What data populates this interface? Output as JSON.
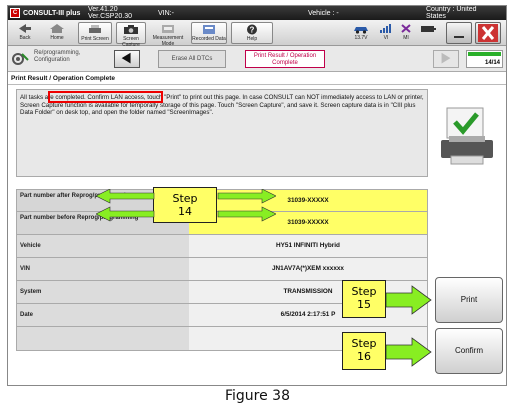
{
  "titlebar": {
    "app_name": "CONSULT-III plus",
    "version1": "Ver.41.20",
    "version2": "Ver.CSP20.30",
    "vin_label": "VIN:-",
    "vehicle_label": "Vehicle : -",
    "country_label": "Country : United",
    "country_label2": "States"
  },
  "toolbar": {
    "back": "Back",
    "home": "Home",
    "print_screen": "Print Screen",
    "screen_capture": "Screen Capture",
    "measurement_mode": "Measurement Mode",
    "recorded_data": "Recorded Data",
    "help": "Help",
    "voltage": "13.7V",
    "vi": "VI",
    "mi": "MI"
  },
  "navbar": {
    "crumb1": "Re/programming, Configuration",
    "crumb2": "Erase All DTCs",
    "crumb3": "Print Result / Operation Complete",
    "page_counter": "14/14"
  },
  "page_title": "Print Result / Operation Complete",
  "message": "All tasks are completed. Confirm LAN access, touch \"Print\" to print out this page. In case CONSULT can NOT immediately access to LAN or printer, Screen Capture function is available for temporally storage of this page. Touch \"Screen Capture\", and save it. Screen capture data is in \"CIII plus Data Folder\" on desk top, and open the folder named \"ScreenImages\".",
  "rows": [
    {
      "label": "Part number after Reprog/programming",
      "value": "31039-XXXXX"
    },
    {
      "label": "Part number before Reprog/programming",
      "value": "31039-XXXXX"
    },
    {
      "label": "Vehicle",
      "value": "HY51 INFINITI Hybrid"
    },
    {
      "label": "VIN",
      "value": "JN1AV7A(*)XEM xxxxxx"
    },
    {
      "label": "System",
      "value": "TRANSMISSION"
    },
    {
      "label": "Date",
      "value": "6/5/2014 2:17:51 P"
    }
  ],
  "buttons": {
    "print": "Print",
    "confirm": "Confirm"
  },
  "steps": {
    "step14_line1": "Step",
    "step14_line2": "14",
    "step15_line1": "Step",
    "step15_line2": "15",
    "step16_line1": "Step",
    "step16_line2": "16"
  },
  "caption": "Figure 38",
  "colors": {
    "highlight": "#ffff66",
    "arrow": "#88ee22",
    "redbox": "#e00000"
  }
}
